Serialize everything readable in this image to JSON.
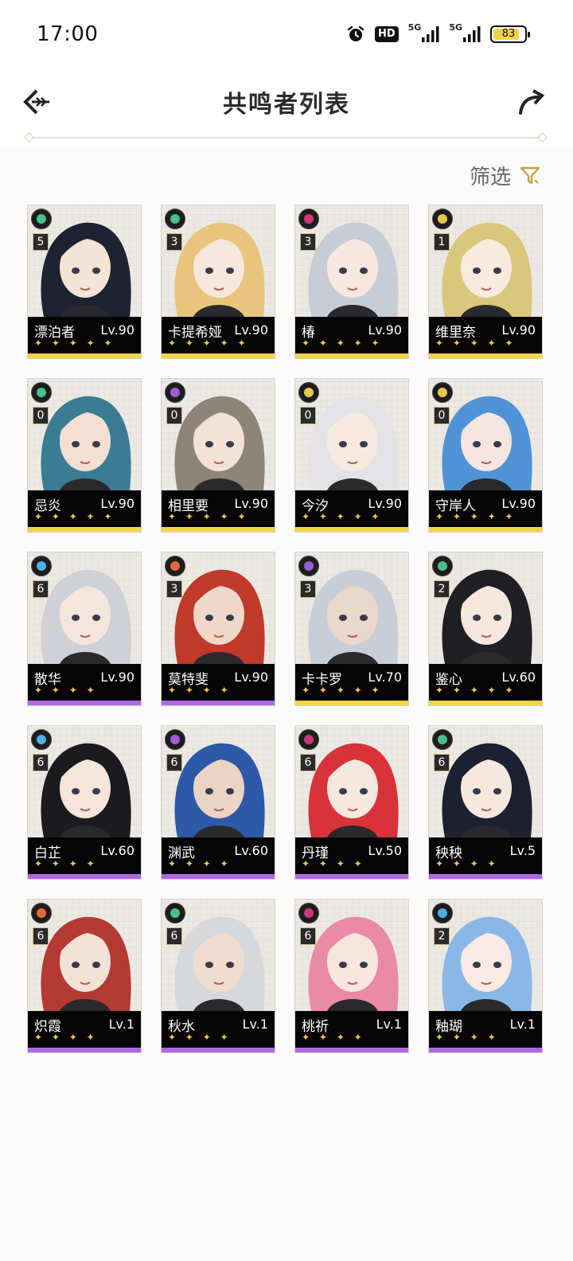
{
  "status_bar": {
    "time": "17:00",
    "hd_label": "HD",
    "network_1": "5G",
    "network_2": "5G",
    "battery": "83",
    "battery_level": 0.83
  },
  "header": {
    "title": "共鸣者列表"
  },
  "filter": {
    "label": "筛选"
  },
  "colors": {
    "five_star": "#f2d44a",
    "four_star": "#b067e6",
    "star": "#f3c94c"
  },
  "characters": [
    {
      "name": "漂泊者",
      "level": "Lv.90",
      "rank": "5",
      "stars": "✦ ✦ ✦ ✦ ✦",
      "element_icon": "aero-icon",
      "element_color": "#48c08a",
      "rarity_color": "#f2d44a",
      "hair": "#1d2330",
      "skin": "#f4e4d6"
    },
    {
      "name": "卡提希娅",
      "level": "Lv.90",
      "rank": "3",
      "stars": "✦ ✦ ✦ ✦ ✦",
      "element_icon": "aero-icon",
      "element_color": "#48c08a",
      "rarity_color": "#f2d44a",
      "hair": "#e9c47c",
      "skin": "#f6e7dc"
    },
    {
      "name": "椿",
      "level": "Lv.90",
      "rank": "3",
      "stars": "✦ ✦ ✦ ✦ ✦",
      "element_icon": "havoc-icon",
      "element_color": "#d1367a",
      "rarity_color": "#f2d44a",
      "hair": "#c8ccd4",
      "skin": "#f6e8df"
    },
    {
      "name": "维里奈",
      "level": "Lv.90",
      "rank": "1",
      "stars": "✦ ✦ ✦ ✦ ✦",
      "element_icon": "spectro-icon",
      "element_color": "#e6c94a",
      "rarity_color": "#f2d44a",
      "hair": "#d9c77c",
      "skin": "#f8eadd"
    },
    {
      "name": "忌炎",
      "level": "Lv.90",
      "rank": "0",
      "stars": "✦ ✦ ✦ ✦ ✦",
      "element_icon": "aero-icon",
      "element_color": "#48c08a",
      "rarity_color": "#f2d44a",
      "hair": "#3b7c93",
      "skin": "#f4dfd3"
    },
    {
      "name": "相里要",
      "level": "Lv.90",
      "rank": "0",
      "stars": "✦ ✦ ✦ ✦ ✦",
      "element_icon": "electro-icon",
      "element_color": "#9a5fd6",
      "rarity_color": "#f2d44a",
      "hair": "#8f8478",
      "skin": "#f3e3d6"
    },
    {
      "name": "今汐",
      "level": "Lv.90",
      "rank": "0",
      "stars": "✦ ✦ ✦ ✦ ✦",
      "element_icon": "spectro-icon",
      "element_color": "#e6c94a",
      "rarity_color": "#f2d44a",
      "hair": "#e3e3e6",
      "skin": "#f6eae0"
    },
    {
      "name": "守岸人",
      "level": "Lv.90",
      "rank": "0",
      "stars": "✦ ✦ ✦ ✦ ✦",
      "element_icon": "spectro-icon",
      "element_color": "#e6c94a",
      "rarity_color": "#f2d44a",
      "hair": "#4f93d6",
      "skin": "#f3e6e0"
    },
    {
      "name": "散华",
      "level": "Lv.90",
      "rank": "6",
      "stars": "✦ ✦ ✦ ✦",
      "element_icon": "glacio-icon",
      "element_color": "#4ab1e6",
      "rarity_color": "#b067e6",
      "hair": "#cfd1d6",
      "skin": "#f5e6dc"
    },
    {
      "name": "莫特斐",
      "level": "Lv.90",
      "rank": "3",
      "stars": "✦ ✦ ✦ ✦",
      "element_icon": "fusion-icon",
      "element_color": "#e6673a",
      "rarity_color": "#b067e6",
      "hair": "#c0392b",
      "skin": "#efd8c7"
    },
    {
      "name": "卡卡罗",
      "level": "Lv.70",
      "rank": "3",
      "stars": "✦ ✦ ✦ ✦ ✦",
      "element_icon": "electro-icon",
      "element_color": "#9a5fd6",
      "rarity_color": "#f2d44a",
      "hair": "#c9ced6",
      "skin": "#ead8cc"
    },
    {
      "name": "鉴心",
      "level": "Lv.60",
      "rank": "2",
      "stars": "✦ ✦ ✦ ✦ ✦",
      "element_icon": "aero-icon",
      "element_color": "#48c08a",
      "rarity_color": "#f2d44a",
      "hair": "#1f1f24",
      "skin": "#f6e8de"
    },
    {
      "name": "白芷",
      "level": "Lv.60",
      "rank": "6",
      "stars": "✦ ✦ ✦ ✦",
      "element_icon": "glacio-icon",
      "element_color": "#4ab1e6",
      "rarity_color": "#b067e6",
      "hair": "#1b1b1f",
      "skin": "#f5e5da"
    },
    {
      "name": "渊武",
      "level": "Lv.60",
      "rank": "6",
      "stars": "✦ ✦ ✦ ✦",
      "element_icon": "electro-icon",
      "element_color": "#9a5fd6",
      "rarity_color": "#b067e6",
      "hair": "#2d5aa8",
      "skin": "#ebd4c3"
    },
    {
      "name": "丹瑾",
      "level": "Lv.50",
      "rank": "6",
      "stars": "✦ ✦ ✦ ✦",
      "element_icon": "havoc-icon",
      "element_color": "#d1367a",
      "rarity_color": "#b067e6",
      "hair": "#d9333a",
      "skin": "#f7e8df"
    },
    {
      "name": "秧秧",
      "level": "Lv.5",
      "rank": "6",
      "stars": "✦ ✦ ✦ ✦",
      "element_icon": "aero-icon",
      "element_color": "#48c08a",
      "rarity_color": "#b067e6",
      "hair": "#1d2030",
      "skin": "#f6e8de"
    },
    {
      "name": "炽霞",
      "level": "Lv.1",
      "rank": "6",
      "stars": "✦ ✦ ✦ ✦",
      "element_icon": "fusion-icon",
      "element_color": "#e6673a",
      "rarity_color": "#b067e6",
      "hair": "#b53a33",
      "skin": "#f5e2d6"
    },
    {
      "name": "秋水",
      "level": "Lv.1",
      "rank": "6",
      "stars": "✦ ✦ ✦ ✦",
      "element_icon": "aero-icon",
      "element_color": "#48c08a",
      "rarity_color": "#b067e6",
      "hair": "#d6d8dc",
      "skin": "#f0ddd0"
    },
    {
      "name": "桃祈",
      "level": "Lv.1",
      "rank": "6",
      "stars": "✦ ✦ ✦ ✦",
      "element_icon": "havoc-icon",
      "element_color": "#d1367a",
      "rarity_color": "#b067e6",
      "hair": "#e88aa8",
      "skin": "#f6e6de"
    },
    {
      "name": "釉瑚",
      "level": "Lv.1",
      "rank": "2",
      "stars": "✦ ✦ ✦ ✦",
      "element_icon": "glacio-icon",
      "element_color": "#4ab1e6",
      "rarity_color": "#b067e6",
      "hair": "#8ab8e6",
      "skin": "#f7ebe4"
    }
  ]
}
